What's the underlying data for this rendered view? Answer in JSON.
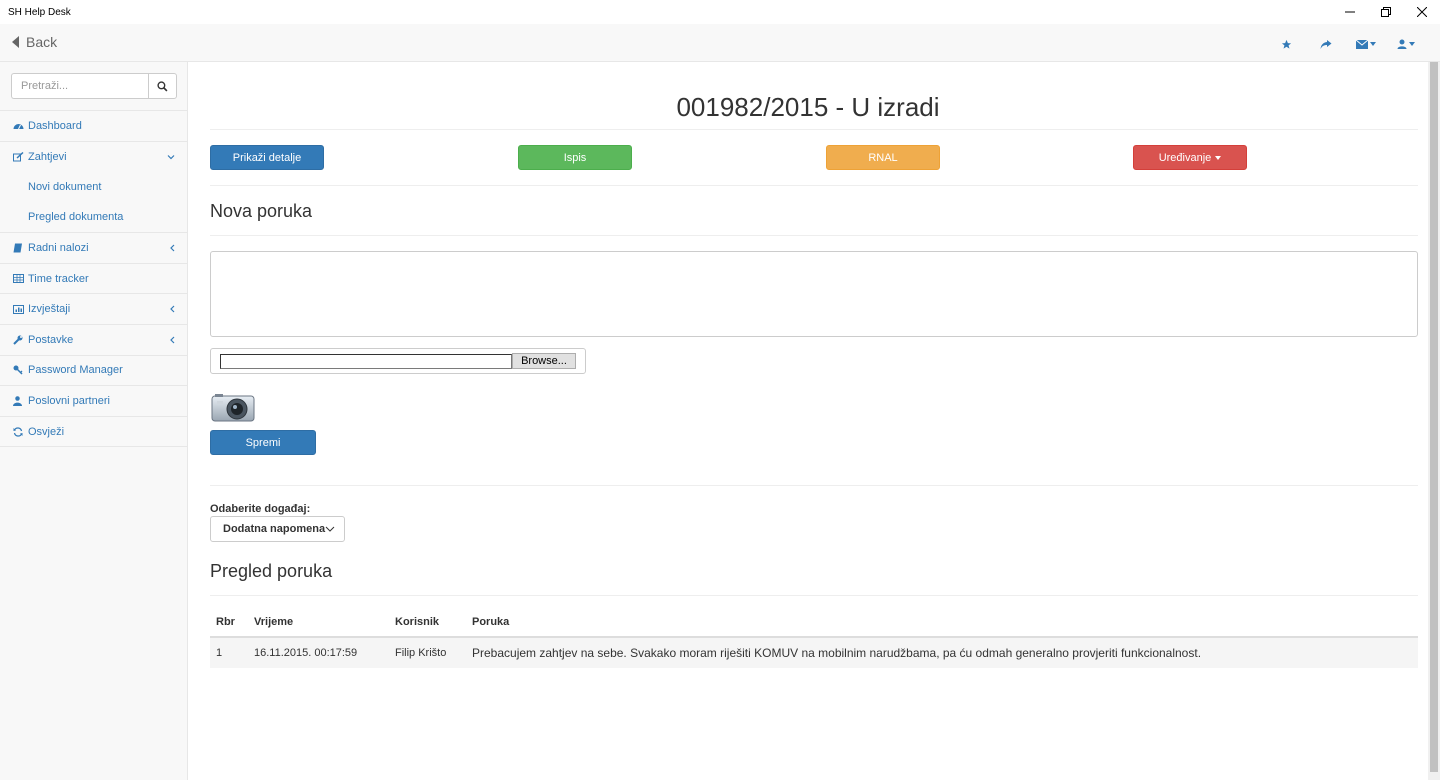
{
  "window": {
    "app_title": "SH Help Desk"
  },
  "navbar": {
    "back_label": "Back"
  },
  "sidebar": {
    "search_placeholder": "Pretraži...",
    "items": [
      {
        "label": "Dashboard"
      },
      {
        "label": "Zahtjevi"
      },
      {
        "label": "Radni nalozi"
      },
      {
        "label": "Time tracker"
      },
      {
        "label": "Izvještaji"
      },
      {
        "label": "Postavke"
      },
      {
        "label": "Password Manager"
      },
      {
        "label": "Poslovni partneri"
      },
      {
        "label": "Osvježi"
      }
    ],
    "subitems": [
      {
        "label": "Novi dokument"
      },
      {
        "label": "Pregled dokumenta"
      }
    ]
  },
  "main": {
    "title": "001982/2015 - U izradi",
    "actions": {
      "details": "Prikaži detalje",
      "print": "Ispis",
      "rnal": "RNAL",
      "edit": "Uređivanje"
    },
    "new_message_heading": "Nova poruka",
    "browse_label": "Browse...",
    "save_label": "Spremi",
    "event_label": "Odaberite događaj:",
    "event_selected": "Dodatna napomena",
    "messages_heading": "Pregled poruka",
    "table": {
      "headers": [
        "Rbr",
        "Vrijeme",
        "Korisnik",
        "Poruka"
      ],
      "rows": [
        [
          "1",
          "16.11.2015. 00:17:59",
          "Filip Krišto",
          "Prebacujem zahtjev na sebe. Svakako moram riješiti KOMUV na mobilnim narudžbama, pa ću odmah generalno provjeriti funkcionalnost."
        ]
      ]
    }
  },
  "colors": {
    "primary": "#337ab7",
    "success": "#5cb85c",
    "warning": "#f0ad4e",
    "danger": "#d9534f"
  }
}
